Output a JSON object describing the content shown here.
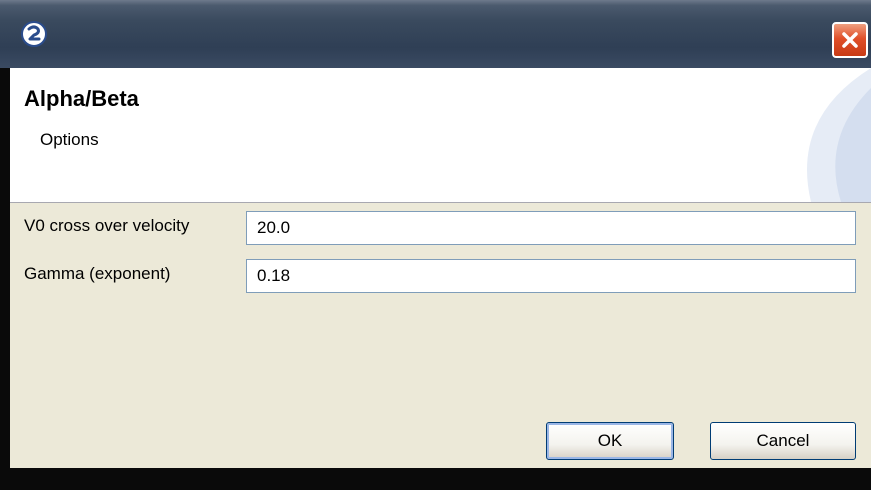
{
  "window": {
    "icon": "eclipse-app-icon",
    "close_icon": "close-icon"
  },
  "header": {
    "title": "Alpha/Beta",
    "subtitle": "Options"
  },
  "fields": [
    {
      "label": "V0 cross over velocity",
      "value": "20.0"
    },
    {
      "label": "Gamma (exponent)",
      "value": "0.18"
    }
  ],
  "buttons": {
    "ok": "OK",
    "cancel": "Cancel"
  },
  "colors": {
    "titlebar": "#3a4a5e",
    "close_button": "#e0502a",
    "content_bg": "#ece9d8",
    "input_border": "#7f9db9"
  }
}
